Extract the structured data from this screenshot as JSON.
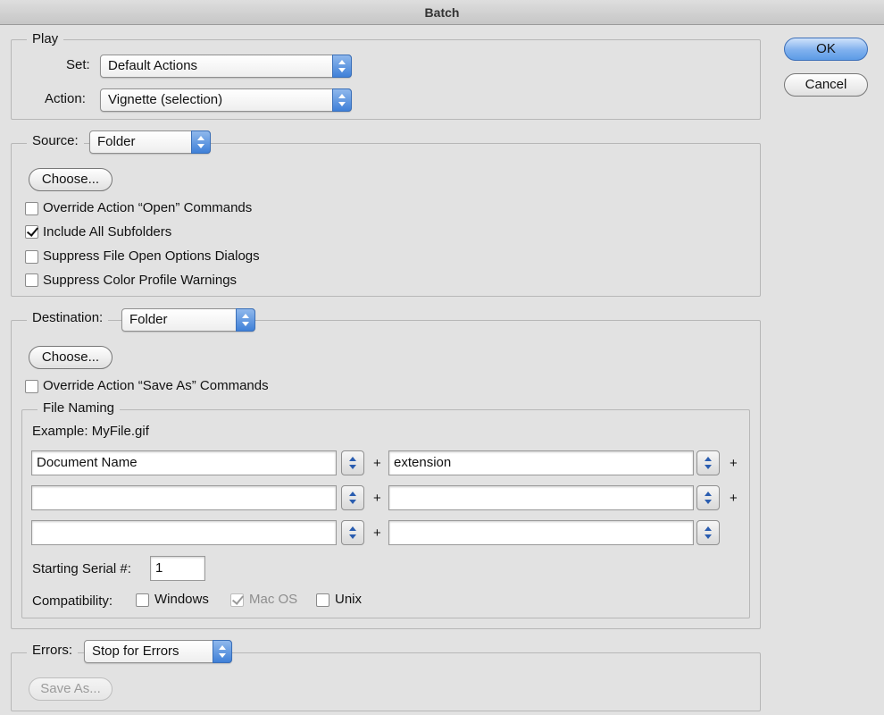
{
  "window": {
    "title": "Batch"
  },
  "buttons": {
    "ok": "OK",
    "cancel": "Cancel"
  },
  "play": {
    "legend": "Play",
    "set_label": "Set:",
    "set_value": "Default Actions",
    "action_label": "Action:",
    "action_value": "Vignette (selection)"
  },
  "source": {
    "label": "Source:",
    "value": "Folder",
    "choose": "Choose...",
    "options": [
      {
        "label": "Override Action “Open” Commands",
        "checked": false
      },
      {
        "label": "Include All Subfolders",
        "checked": true
      },
      {
        "label": "Suppress File Open Options Dialogs",
        "checked": false
      },
      {
        "label": "Suppress Color Profile Warnings",
        "checked": false
      }
    ]
  },
  "destination": {
    "label": "Destination:",
    "value": "Folder",
    "choose": "Choose...",
    "override": {
      "label": "Override Action “Save As” Commands",
      "checked": false
    },
    "naming": {
      "legend": "File Naming",
      "example": "Example: MyFile.gif",
      "fields": [
        "Document Name",
        "extension",
        "",
        "",
        "",
        ""
      ],
      "plus": "+",
      "serial_label": "Starting Serial #:",
      "serial_value": "1",
      "compat_label": "Compatibility:",
      "compat": [
        {
          "label": "Windows",
          "checked": false,
          "enabled": true
        },
        {
          "label": "Mac OS",
          "checked": true,
          "enabled": false
        },
        {
          "label": "Unix",
          "checked": false,
          "enabled": true
        }
      ]
    }
  },
  "errors": {
    "label": "Errors:",
    "value": "Stop for Errors",
    "save_as": "Save As..."
  }
}
